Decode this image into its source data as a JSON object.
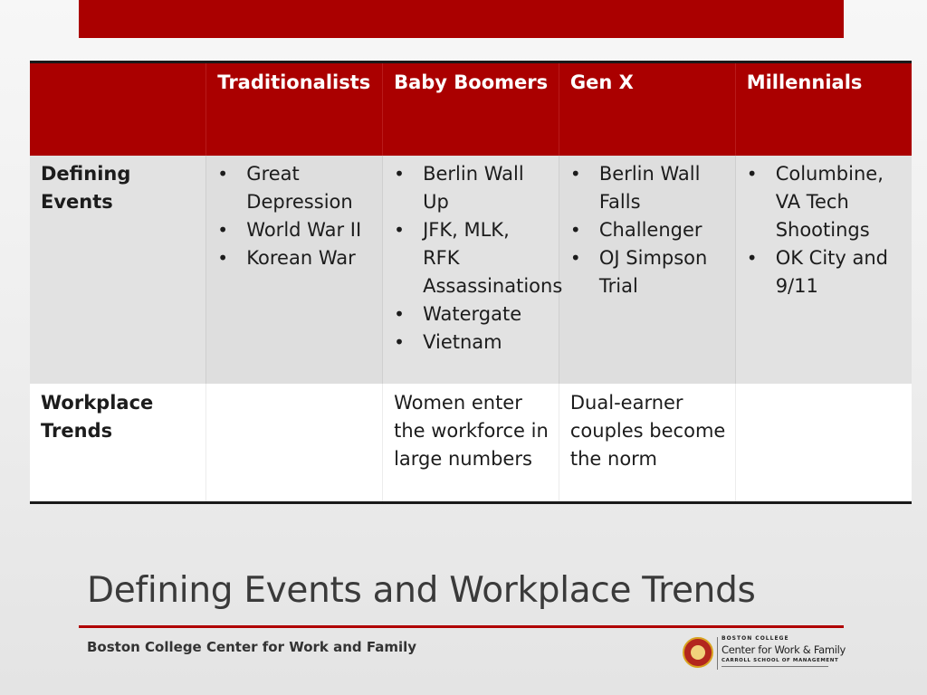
{
  "table": {
    "headers": [
      "",
      "Traditionalists",
      "Baby Boomers",
      "Gen X",
      "Millennials"
    ],
    "rows": [
      {
        "label": "Defining Events",
        "cells": [
          [
            "Great Depression",
            "World War II",
            "Korean War"
          ],
          [
            "Berlin Wall Up",
            "JFK, MLK, RFK Assassinations",
            "Watergate",
            "Vietnam"
          ],
          [
            "Berlin Wall Falls",
            "Challenger",
            "OJ Simpson Trial"
          ],
          [
            "Columbine, VA Tech Shootings",
            "OK City and 9/11"
          ]
        ]
      },
      {
        "label": "Workplace Trends",
        "cells": [
          "",
          "Women enter the workforce in large numbers",
          "Dual-earner couples become the norm",
          ""
        ]
      }
    ]
  },
  "slide": {
    "title": "Defining Events and Workplace Trends",
    "footer": "Boston College Center for Work and Family"
  },
  "logo": {
    "top_text": "BOSTON COLLEGE",
    "main_text": "Center for Work & Family",
    "bottom_text": "CARROLL SCHOOL OF MANAGEMENT"
  },
  "colors": {
    "accent": "#aa0000",
    "table_row_shade": "#dedede",
    "title_text": "#3a3a3a"
  }
}
